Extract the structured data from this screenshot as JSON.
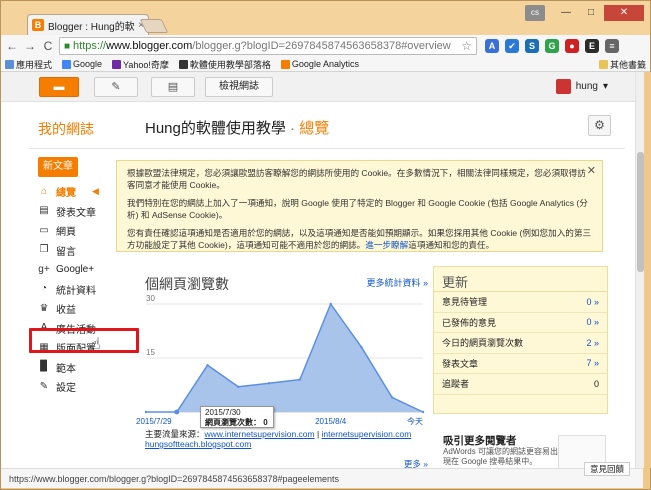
{
  "browser": {
    "tab_title": "Blogger : Hung的軟體使",
    "tab_close": "×",
    "favicon": "B",
    "window": {
      "user": "cs",
      "minimize": "—",
      "maximize": "□",
      "close": "✕"
    },
    "nav": {
      "back": "←",
      "forward": "→",
      "reload": "C"
    },
    "url": {
      "https": "https://",
      "host": "www.blogger.com",
      "path": "/blogger.g?blogID=2697845874563658378#overview"
    },
    "star": "☆",
    "extensions": [
      {
        "name": "translate-extension",
        "glyph": "A",
        "color": "#3a6fd8"
      },
      {
        "name": "tools-extension",
        "glyph": "✔",
        "color": "#2a7ad5"
      },
      {
        "name": "s-extension",
        "glyph": "S",
        "color": "#1c6fb5"
      },
      {
        "name": "google-extension",
        "glyph": "G",
        "color": "#2ea34a"
      },
      {
        "name": "record-extension",
        "glyph": "●",
        "color": "#cc2222"
      },
      {
        "name": "evernote-extension",
        "glyph": "E",
        "color": "#2b2b2b"
      },
      {
        "name": "menu-extension",
        "glyph": "≡",
        "color": "#666666"
      }
    ],
    "bookmarks": [
      {
        "label": "應用程式",
        "color": "#5b8fd8"
      },
      {
        "label": "Google",
        "color": "#4285f4"
      },
      {
        "label": "Yahoo!奇摩",
        "color": "#6e2aa7"
      },
      {
        "label": "軟體使用教學部落格",
        "color": "#333333"
      },
      {
        "label": "Google Analytics",
        "color": "#f57d00"
      }
    ],
    "bookmarks_other": "其他書籤",
    "status_url": "https://www.blogger.com/blogger.g?blogID=2697845874563658378#pageelements"
  },
  "topbar": {
    "blogger_button": "▬",
    "pencil_button": "✎",
    "doc_button": "▤",
    "view_blog": "檢視網誌",
    "user": "hung",
    "user_caret": "▾"
  },
  "header": {
    "my_blogs": "我的網誌",
    "blog_title": "Hung的軟體使用教學",
    "separator": " · ",
    "section": "總覽",
    "gear": "⚙"
  },
  "sidebar": {
    "new_post": "新文章",
    "items": [
      {
        "label": "總覽",
        "icon": "⌂"
      },
      {
        "label": "發表文章",
        "icon": "▤"
      },
      {
        "label": "網頁",
        "icon": "▭"
      },
      {
        "label": "留言",
        "icon": "❐"
      },
      {
        "label": "Google+",
        "icon": "g+"
      },
      {
        "label": "統計資料",
        "icon": "◔"
      },
      {
        "label": "收益",
        "icon": "♛"
      },
      {
        "label": "廣告活動",
        "icon": "A"
      },
      {
        "label": "版面配置",
        "icon": "▦"
      },
      {
        "label": "範本",
        "icon": "▉"
      },
      {
        "label": "設定",
        "icon": "✎"
      }
    ],
    "megaphone": "◀"
  },
  "cookie_notice": {
    "p1": "根據歐盟法律規定，您必須讓歐盟訪客瞭解您的網誌所使用的 Cookie。在多數情況下，相關法律同樣規定，您必須取得訪客同意才能使用 Cookie。",
    "p2": "我們特別在您的網誌上加入了一項通知，說明 Google 使用了特定的 Blogger 和 Google Cookie (包括 Google Analytics (分析) 和 AdSense Cookie)。",
    "p3_a": "您有責任確認這項通知是否適用於您的網誌，以及這項通知是否能如預期顯示。如果您採用其他 Cookie (例如您加入的第三方功能設定了其他 Cookie)，這項通知可能不適用於您的網誌。",
    "p3_link": "進一步瞭解",
    "p3_b": "這項通知和您的責任。",
    "close": "✕"
  },
  "chart_data": {
    "type": "area",
    "title": "個網頁瀏覽數",
    "more_stats": "更多統計資料 »",
    "x": [
      "2015/7/29",
      "2015/7/30",
      "2015/7/31",
      "2015/8/1",
      "2015/8/2",
      "2015/8/3",
      "2015/8/4",
      "2015/8/5",
      "2015/8/6",
      "今天"
    ],
    "series": [
      {
        "values": [
          0,
          0,
          13,
          7,
          8,
          9,
          30,
          18,
          4,
          0
        ]
      }
    ],
    "tick_labels_y": [
      "30",
      "15"
    ],
    "tick_labels_x": [
      "2015/7/29",
      "2015/8/4",
      "今天"
    ],
    "ylim": [
      0,
      30
    ],
    "color": "#a9c4ea",
    "line_color": "#5b8fe3",
    "tooltip": {
      "date": "2015/7/30",
      "label": "網頁瀏覽次數：",
      "value": "0"
    }
  },
  "sources": {
    "label": "主要流量來源：",
    "link1": "www.internetsupervision.com",
    "separator": " | ",
    "link2": "internetsupervision.com",
    "link3": "hungsoftteach.blogspot.com",
    "more": "更多 »"
  },
  "updates": {
    "title": "更新",
    "rows": [
      {
        "label": "意見待管理",
        "value": "0 »"
      },
      {
        "label": "已發佈的意見",
        "value": "0 »"
      },
      {
        "label": "今日的網頁瀏覽次數",
        "value": "2 »"
      },
      {
        "label": "發表文章",
        "value": "7 »"
      },
      {
        "label": "追蹤者",
        "value": "0"
      }
    ]
  },
  "adsense": {
    "title": "吸引更多閱覽者",
    "body": "AdWords 可讓您的網誌更容易出現在 Google 搜尋結果中。"
  },
  "feedback": "意見回饋"
}
